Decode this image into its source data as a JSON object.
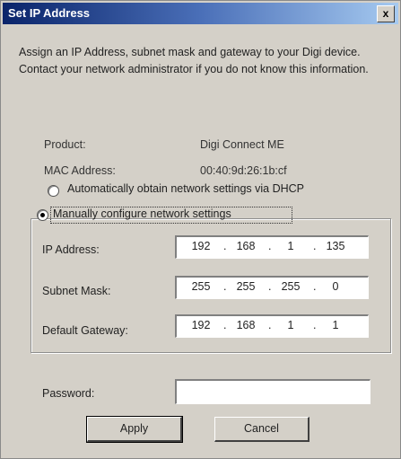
{
  "dialog": {
    "title": "Set IP Address",
    "close_label": "x"
  },
  "intro_text": "Assign an IP Address, subnet mask and gateway to your Digi device.  Contact your network administrator if you do not know this information.",
  "info": {
    "product_label": "Product:",
    "product_value": "Digi Connect ME",
    "mac_label": "MAC Address:",
    "mac_value": "00:40:9d:26:1b:cf"
  },
  "options": {
    "dhcp_label": "Automatically obtain network settings via DHCP",
    "dhcp_selected": false,
    "manual_label": "Manually configure network settings",
    "manual_selected": true
  },
  "fields": {
    "ip": {
      "label": "IP Address:",
      "octets": [
        "192",
        "168",
        "1",
        "135"
      ]
    },
    "subnet": {
      "label": "Subnet Mask:",
      "octets": [
        "255",
        "255",
        "255",
        "0"
      ]
    },
    "gateway": {
      "label": "Default Gateway:",
      "octets": [
        "192",
        "168",
        "1",
        "1"
      ]
    }
  },
  "password": {
    "label": "Password:",
    "value": ""
  },
  "buttons": {
    "apply": "Apply",
    "cancel": "Cancel"
  }
}
